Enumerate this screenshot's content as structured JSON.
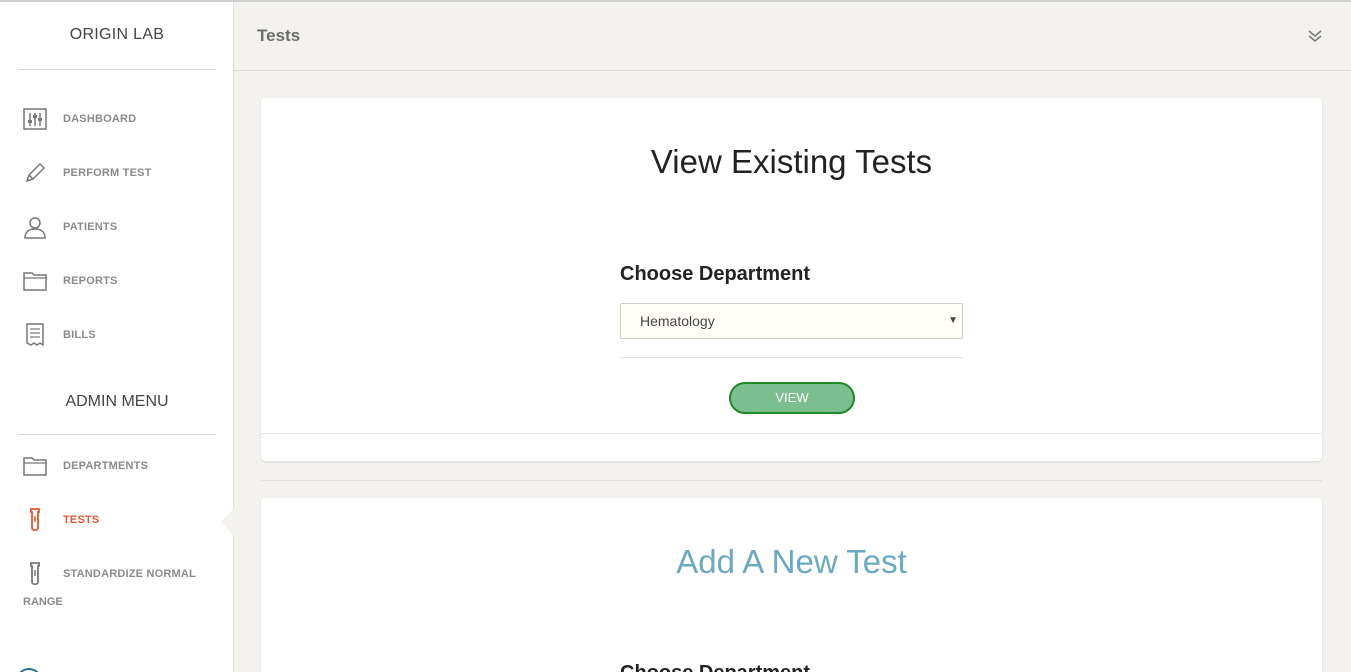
{
  "sidebar": {
    "brand": "ORIGIN LAB",
    "items": [
      {
        "label": "DASHBOARD",
        "icon": "sliders-icon"
      },
      {
        "label": "PERFORM TEST",
        "icon": "pen-icon"
      },
      {
        "label": "PATIENTS",
        "icon": "user-icon"
      },
      {
        "label": "REPORTS",
        "icon": "folder-icon"
      },
      {
        "label": "BILLS",
        "icon": "receipt-icon"
      }
    ],
    "admin_title": "ADMIN MENU",
    "admin_items": [
      {
        "label": "DEPARTMENTS",
        "icon": "folder-icon"
      },
      {
        "label": "TESTS",
        "icon": "test-tube-icon",
        "active": true
      },
      {
        "label_line1": "STANDARDIZE NORMAL",
        "label_line2": "RANGE",
        "icon": "test-tube-icon"
      }
    ]
  },
  "header": {
    "title": "Tests",
    "collapse_icon": "double-chevron-down-icon"
  },
  "view_card": {
    "title": "View Existing Tests",
    "field_label": "Choose Department",
    "selected_department": "Hematology",
    "button_label": "VIEW"
  },
  "add_card": {
    "title": "Add A New Test",
    "field_label": "Choose Department"
  },
  "colors": {
    "active": "#e2572f",
    "button_border": "#1e8a26",
    "button_fill": "#7cbf8f",
    "add_title": "#6aa9c2"
  }
}
